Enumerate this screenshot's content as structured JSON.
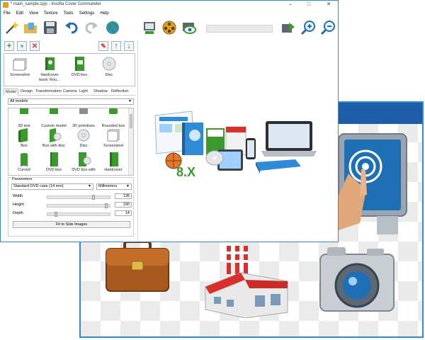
{
  "window": {
    "title": "* main_sample.cpjs - Insofta Cover Commander",
    "controls": [
      "–",
      "□",
      "✕"
    ]
  },
  "menu": [
    "File",
    "Edit",
    "View",
    "Texture",
    "Tools",
    "Settings",
    "Help"
  ],
  "objects": [
    {
      "label": "Screenshot"
    },
    {
      "label": "Hardcover book: Rou..."
    },
    {
      "label": "DVD box"
    },
    {
      "label": "Disc"
    }
  ],
  "tabs": [
    "Model",
    "Design",
    "Transformation",
    "Camera",
    "Light",
    "Shadow",
    "Reflection"
  ],
  "models_select": "All models",
  "gallery": [
    "3D text",
    "Custom model",
    "3D primitives",
    "Rounded box",
    "Box",
    "Box with disc",
    "Disc",
    "Screenshot",
    "Curved",
    "DVD box",
    "DVD box with",
    "Hardcover"
  ],
  "parameters": {
    "legend": "Parameters",
    "preset": "Standard DVD case (14 mm)",
    "units": "Millimeters",
    "rows": [
      {
        "label": "Width",
        "value": "135",
        "fraction": 0.75
      },
      {
        "label": "Height",
        "value": "190",
        "fraction": 0.97
      },
      {
        "label": "Depth",
        "value": "14",
        "fraction": 0.12
      }
    ],
    "fit_button": "Fit to Side Images"
  },
  "preview_badge": "8.X",
  "colors": {
    "accent": "#2f8bd6",
    "back_titlebar": "#1e5ea8",
    "green": "#3a9a2c",
    "red": "#d8312b"
  }
}
